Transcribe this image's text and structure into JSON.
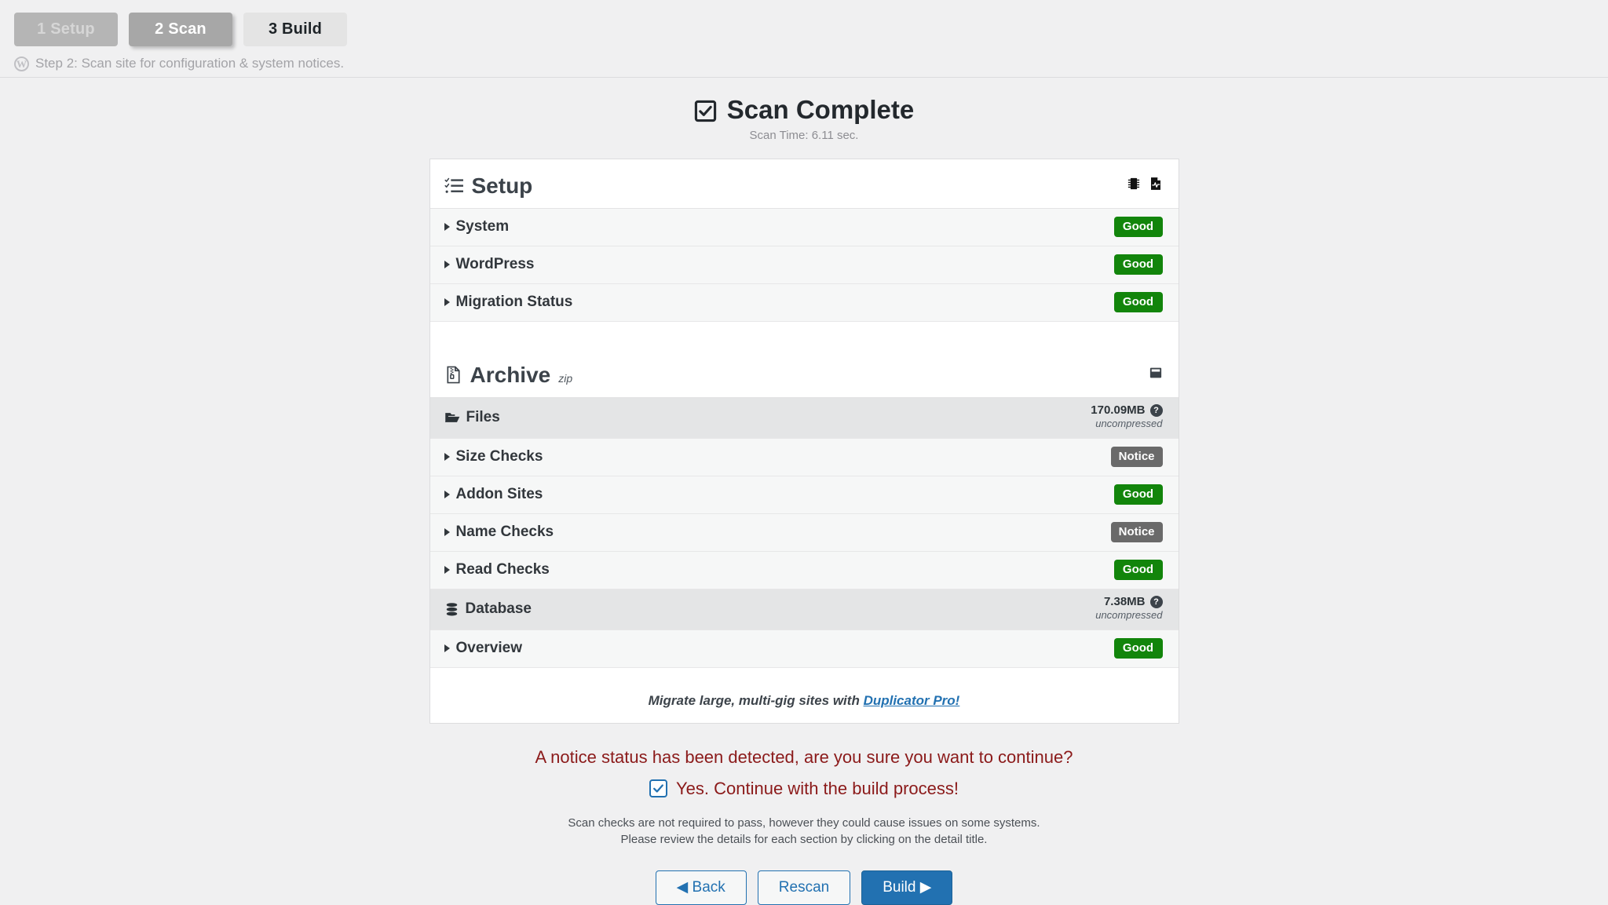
{
  "steps": [
    {
      "label": "1 Setup",
      "state": "done"
    },
    {
      "label": "2 Scan",
      "state": "active"
    },
    {
      "label": "3 Build",
      "state": "todo"
    }
  ],
  "step_note": "Step 2: Scan site for configuration & system notices.",
  "step_note_icon": "wordpress-icon",
  "header": {
    "title": "Scan Complete",
    "icon": "checked-box-icon",
    "scan_time": "Scan Time: 6.11 sec."
  },
  "setup": {
    "title": "Setup",
    "icon": "checklist-icon",
    "head_icons": [
      "memory-chip-icon",
      "file-pulse-icon"
    ],
    "rows": [
      {
        "label": "System",
        "status": "Good",
        "type": "good"
      },
      {
        "label": "WordPress",
        "status": "Good",
        "type": "good"
      },
      {
        "label": "Migration Status",
        "status": "Good",
        "type": "good"
      }
    ]
  },
  "archive": {
    "title": "Archive",
    "superscript": "zip",
    "icon": "file-archive-icon",
    "head_icon": "archive-box-icon",
    "groups": [
      {
        "label": "Files",
        "icon": "folder-icon",
        "size": "170.09MB",
        "size_note": "uncompressed",
        "help_icon": "question-mark-icon",
        "rows": [
          {
            "label": "Size Checks",
            "status": "Notice",
            "type": "notice"
          },
          {
            "label": "Addon Sites",
            "status": "Good",
            "type": "good"
          },
          {
            "label": "Name Checks",
            "status": "Notice",
            "type": "notice"
          },
          {
            "label": "Read Checks",
            "status": "Good",
            "type": "good"
          }
        ]
      },
      {
        "label": "Database",
        "icon": "database-icon",
        "size": "7.38MB",
        "size_note": "uncompressed",
        "help_icon": "question-mark-icon",
        "rows": [
          {
            "label": "Overview",
            "status": "Good",
            "type": "good"
          }
        ]
      }
    ]
  },
  "promo": {
    "text": "Migrate large, multi-gig sites with ",
    "link": "Duplicator Pro!"
  },
  "footer": {
    "notice": "A notice status has been detected, are you sure you want to continue?",
    "confirm_label": "Yes. Continue with the build process!",
    "confirm_checked": true,
    "help_line_1": "Scan checks are not required to pass, however they could cause issues on some systems.",
    "help_line_2": "Please review the details for each section by clicking on the detail title.",
    "buttons": {
      "back": "◀ Back",
      "rescan": "Rescan",
      "build": "Build ▶"
    }
  },
  "colors": {
    "good": "#12850b",
    "notice": "#6a6a6a",
    "primary": "#2271b1",
    "warning_text": "#8b1a1a"
  }
}
